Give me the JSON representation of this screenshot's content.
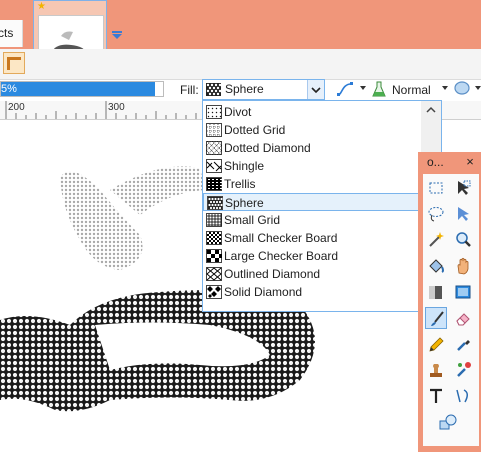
{
  "tabs": {
    "effects_label": "cts"
  },
  "progress": {
    "label": "5%",
    "fraction": 0.95
  },
  "toolbar": {
    "fill_label": "Fill:",
    "fill_value": "Sphere",
    "blend_mode": "Normal"
  },
  "ruler": {
    "labels": [
      "200",
      "300"
    ]
  },
  "fill_options": [
    {
      "label": "Divot",
      "icon": "divot-pattern-icon",
      "selected": false
    },
    {
      "label": "Dotted Grid",
      "icon": "dotted-grid-pattern-icon",
      "selected": false
    },
    {
      "label": "Dotted Diamond",
      "icon": "dotted-diamond-pattern-icon",
      "selected": false
    },
    {
      "label": "Shingle",
      "icon": "shingle-pattern-icon",
      "selected": false
    },
    {
      "label": "Trellis",
      "icon": "trellis-pattern-icon",
      "selected": false
    },
    {
      "label": "Sphere",
      "icon": "sphere-pattern-icon",
      "selected": true
    },
    {
      "label": "Small Grid",
      "icon": "small-grid-pattern-icon",
      "selected": false
    },
    {
      "label": "Small Checker Board",
      "icon": "small-checker-pattern-icon",
      "selected": false
    },
    {
      "label": "Large Checker Board",
      "icon": "large-checker-pattern-icon",
      "selected": false
    },
    {
      "label": "Outlined Diamond",
      "icon": "outlined-diamond-pattern-icon",
      "selected": false
    },
    {
      "label": "Solid Diamond",
      "icon": "solid-diamond-pattern-icon",
      "selected": false
    }
  ],
  "tools_window": {
    "title": "o...",
    "close_label": "×",
    "tools": [
      "rectangle-select-icon",
      "move-selection-icon",
      "lasso-select-icon",
      "move-selection-alt-icon",
      "magic-wand-icon",
      "zoom-icon",
      "paint-bucket-icon",
      "pan-hand-icon",
      "gradient-icon",
      "gradient-fill-icon",
      "paintbrush-icon",
      "eraser-icon",
      "pencil-icon",
      "color-picker-icon",
      "clone-stamp-icon",
      "recolor-icon",
      "text-icon",
      "line-curve-icon",
      "shapes-icon"
    ],
    "active_tool": "paintbrush-icon"
  },
  "colors": {
    "accent_orange": "#f0967a",
    "selection_blue": "#2b8ae0",
    "highlight": "#e5f1fb"
  }
}
